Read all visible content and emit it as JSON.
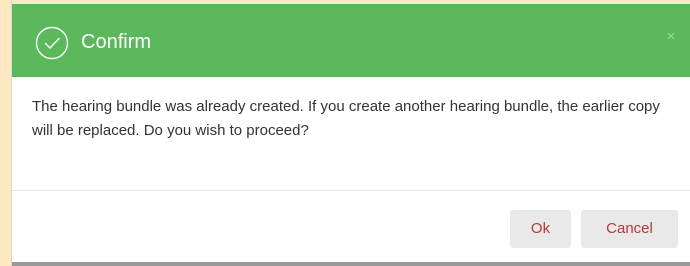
{
  "dialog": {
    "title": "Confirm",
    "close_symbol": "×",
    "message": "The hearing bundle was already created. If you create another hearing bundle, the earlier copy will be replaced. Do you wish to proceed?",
    "icons": {
      "header": "check-circle-icon",
      "close": "close-icon"
    },
    "buttons": {
      "ok_label": "Ok",
      "cancel_label": "Cancel"
    },
    "colors": {
      "header_background": "#5cb85c",
      "button_text": "#b23b3b",
      "button_background": "#e9e9e9",
      "page_background": "#fdebc8"
    }
  }
}
